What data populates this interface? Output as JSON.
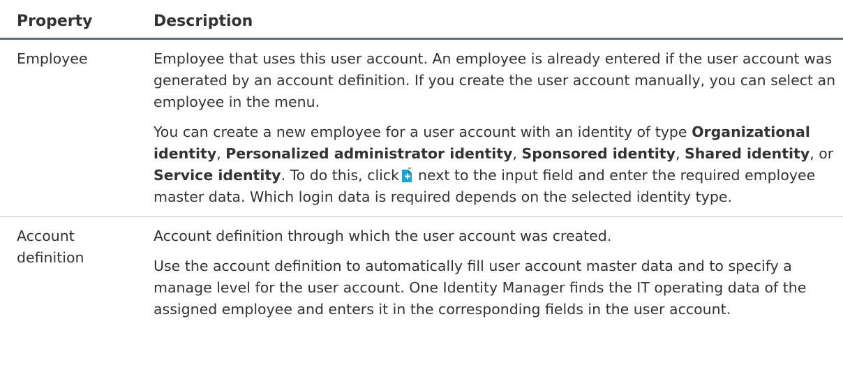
{
  "table": {
    "headers": {
      "property": "Property",
      "description": "Description"
    },
    "rows": [
      {
        "property": "Employee",
        "p1": "Employee that uses this user account. An employee is already entered if the user account was generated by an account definition. If you create the user account manually, you can select an employee in the menu.",
        "p2": {
          "t1": "You can create a new employee for a user account with an identity of type ",
          "b1": "Organizational identity",
          "t2": ", ",
          "b2": "Personalized administrator identity",
          "t3": ", ",
          "b3": "Sponsored identity",
          "t4": ", ",
          "b4": "Shared identity",
          "t5": ", or ",
          "b5": "Service identity",
          "t6": ". To do this, click",
          "icon": "add-new-icon",
          "t7": "next to the input field and enter the required employee master data. Which login data is required depends on the selected identity type."
        }
      },
      {
        "property": "Account definition",
        "p1": "Account definition through which the user account was created.",
        "p2": "Use the account definition to automatically fill user account master data and to specify a manage level for the user account. One Identity Manager finds the IT operating data of the assigned employee and enters it in the corresponding fields in the user account."
      }
    ]
  },
  "colors": {
    "text": "#333333",
    "header_rule": "#5f6d74",
    "row_rule": "#c9c9c9",
    "icon_accent": "#1aa3d9"
  }
}
